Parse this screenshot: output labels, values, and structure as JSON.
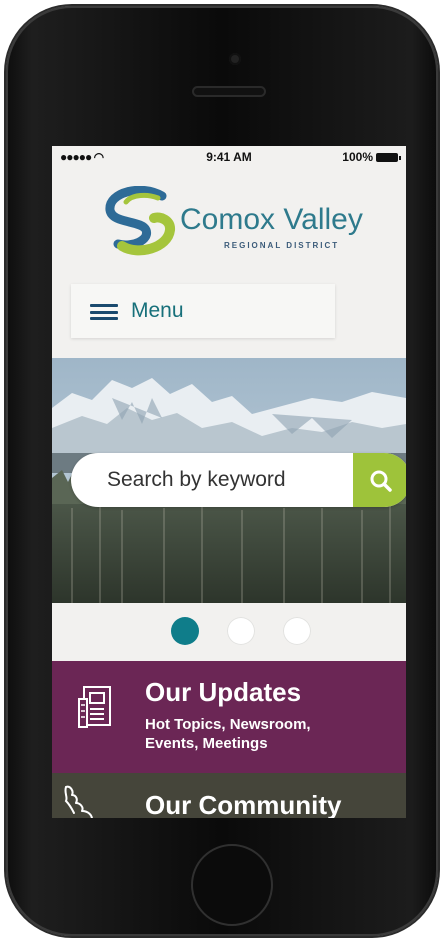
{
  "status_bar": {
    "signal": "●●●●● ◠",
    "time": "9:41 AM",
    "battery": "100%"
  },
  "logo": {
    "title": "Comox Valley",
    "subtitle": "REGIONAL DISTRICT",
    "icon": "s-swoosh-logo-icon"
  },
  "menu": {
    "label": "Menu",
    "icon": "hamburger-icon"
  },
  "search": {
    "placeholder": "Search by keyword",
    "icon": "search-icon"
  },
  "carousel": {
    "total": 3,
    "active_index": 0
  },
  "sections": {
    "updates": {
      "title": "Our Updates",
      "subtitle_lines": [
        "Hot Topics, Newsroom,",
        "Events, Meetings"
      ],
      "icon": "newspaper-icon"
    },
    "community": {
      "title": "Our Community",
      "icon": "island-map-icon"
    }
  },
  "colors": {
    "teal": "#0f7d8a",
    "lime": "#9ec33a",
    "updates_bg": "#6b2655",
    "community_bg": "#45453a",
    "navy": "#1a4a6e"
  }
}
